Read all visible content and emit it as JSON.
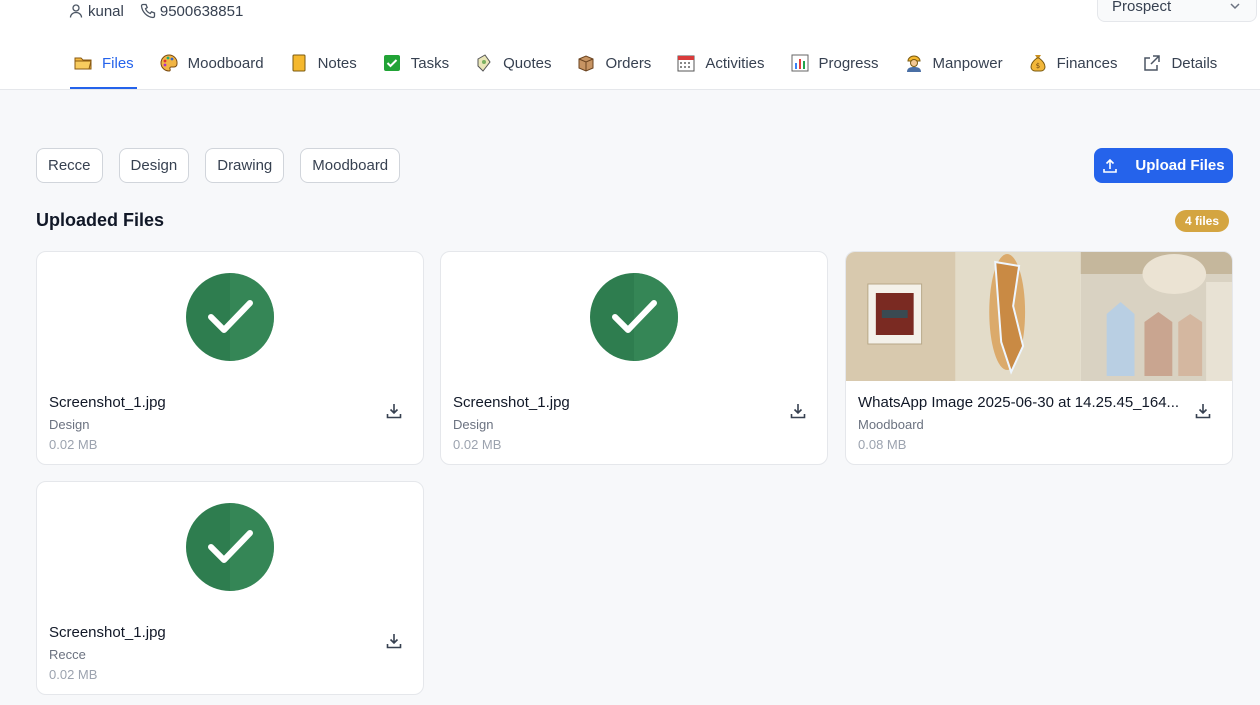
{
  "header": {
    "user_name": "kunal",
    "phone": "9500638851",
    "status_value": "Prospect"
  },
  "tabs": [
    {
      "label": "Files",
      "icon": "folder-icon",
      "active": true
    },
    {
      "label": "Moodboard",
      "icon": "palette-icon"
    },
    {
      "label": "Notes",
      "icon": "note-icon"
    },
    {
      "label": "Tasks",
      "icon": "checkbox-icon"
    },
    {
      "label": "Quotes",
      "icon": "quote-icon"
    },
    {
      "label": "Orders",
      "icon": "package-icon"
    },
    {
      "label": "Activities",
      "icon": "calendar-icon"
    },
    {
      "label": "Progress",
      "icon": "bar-chart-icon"
    },
    {
      "label": "Manpower",
      "icon": "worker-icon"
    },
    {
      "label": "Finances",
      "icon": "money-bag-icon"
    },
    {
      "label": "Details",
      "icon": "external-link-icon"
    }
  ],
  "filters": [
    "Recce",
    "Design",
    "Drawing",
    "Moodboard"
  ],
  "upload_label": "Upload Files",
  "section_title": "Uploaded Files",
  "file_count": "4 files",
  "files": [
    {
      "name": "Screenshot_1.jpg",
      "category": "Design",
      "size": "0.02 MB",
      "thumb": "check-icon"
    },
    {
      "name": "Screenshot_1.jpg",
      "category": "Design",
      "size": "0.02 MB",
      "thumb": "check-icon"
    },
    {
      "name": "WhatsApp Image 2025-06-30 at 14.25.45_164...",
      "category": "Moodboard",
      "size": "0.08 MB",
      "thumb": "photo"
    },
    {
      "name": "Screenshot_1.jpg",
      "category": "Recce",
      "size": "0.02 MB",
      "thumb": "check-icon"
    }
  ],
  "colors": {
    "accent": "#2563eb",
    "badge": "#d4a541",
    "check_green": "#2e7d4f"
  }
}
